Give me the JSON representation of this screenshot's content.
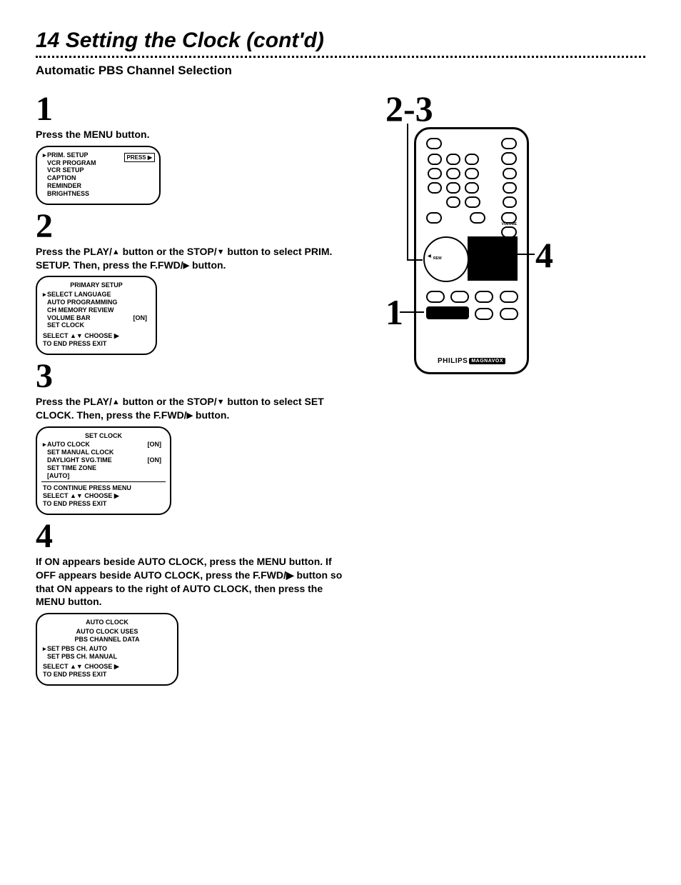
{
  "page": {
    "title": "14  Setting the Clock (cont'd)",
    "subtitle": "Automatic PBS Channel Selection"
  },
  "steps": {
    "s1": {
      "num": "1",
      "text": "Press the MENU button."
    },
    "s2": {
      "num": "2",
      "text_a": "Press the PLAY/",
      "text_b": " button or the STOP/",
      "text_c": " button to select PRIM. SETUP. Then, press the F.FWD/",
      "text_d": " button."
    },
    "s3": {
      "num": "3",
      "text_a": "Press the PLAY/",
      "text_b": " button or the STOP/",
      "text_c": " button to select SET CLOCK. Then, press the F.FWD/",
      "text_d": " button."
    },
    "s4": {
      "num": "4",
      "text": "If ON appears beside AUTO CLOCK, press the MENU button. If OFF appears beside AUTO CLOCK, press the F.FWD/▶ button so that ON appears to the right of AUTO CLOCK, then press the MENU button."
    }
  },
  "screens": {
    "menu": {
      "press": "PRESS ▶",
      "lines": [
        "PRIM. SETUP",
        "VCR PROGRAM",
        "VCR SETUP",
        "CAPTION",
        "REMINDER",
        "BRIGHTNESS"
      ]
    },
    "primary": {
      "title": "PRIMARY SETUP",
      "lines": [
        "SELECT LANGUAGE",
        "AUTO PROGRAMMING",
        "CH MEMORY REVIEW",
        "VOLUME BAR",
        "SET CLOCK"
      ],
      "on": "[ON]",
      "footer1": "SELECT ▲▼  CHOOSE ▶",
      "footer2": "TO  END  PRESS  EXIT"
    },
    "setclock": {
      "title": "SET CLOCK",
      "lines": [
        "AUTO CLOCK",
        "SET MANUAL CLOCK",
        "DAYLIGHT SVG.TIME",
        "SET TIME ZONE",
        "[AUTO]"
      ],
      "on1": "[ON]",
      "on2": "[ON]",
      "cont": "TO CONTINUE PRESS MENU",
      "footer1": "SELECT ▲▼  CHOOSE ▶",
      "footer2": "TO  END  PRESS  EXIT"
    },
    "autoclock": {
      "title": "AUTO CLOCK",
      "sub1": "AUTO CLOCK USES",
      "sub2": "PBS CHANNEL DATA",
      "l1": "SET PBS CH.   AUTO",
      "l2": "SET PBS CH.   MANUAL",
      "footer1": "SELECT ▲▼  CHOOSE ▶",
      "footer2": "TO  END  PRESS  EXIT"
    }
  },
  "right": {
    "num23": "2-3",
    "num4": "4",
    "num1": "1",
    "brand": "PHILIPS",
    "brand2": "MAGNAVOX",
    "rew": "REW"
  }
}
